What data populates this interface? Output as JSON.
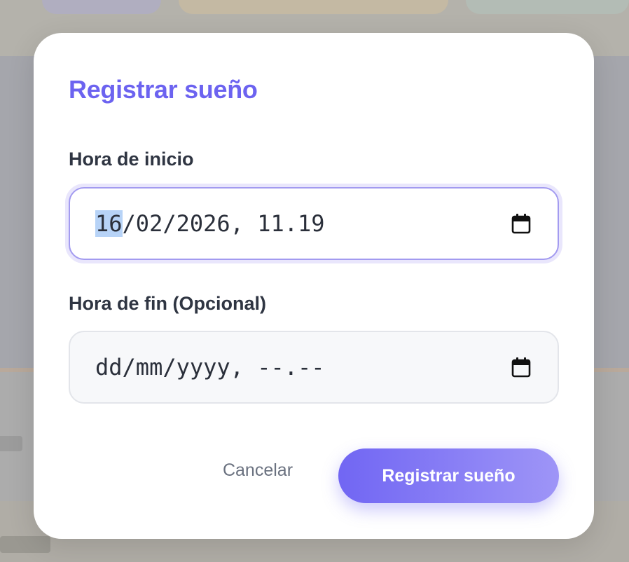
{
  "modal": {
    "title": "Registrar sueño",
    "start_field": {
      "label": "Hora de inicio",
      "value_selected_segment": "16",
      "value_rest": "/02/2026, 11.19",
      "icon": "calendar-icon"
    },
    "end_field": {
      "label": "Hora de fin (Opcional)",
      "placeholder": "dd/mm/yyyy, --.--",
      "icon": "calendar-icon"
    },
    "actions": {
      "cancel_label": "Cancelar",
      "submit_label": "Registrar sueño"
    }
  },
  "colors": {
    "accent": "#6c63f0",
    "accent_light": "#9e95f7",
    "text_dark": "#2f3542",
    "text_muted": "#6b7280"
  }
}
